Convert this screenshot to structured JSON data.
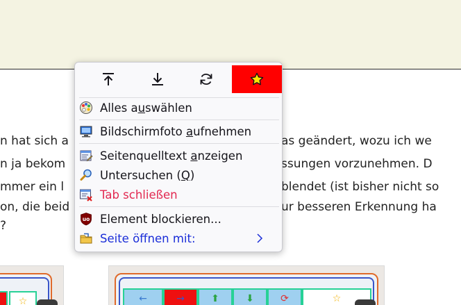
{
  "article": {
    "lines": [
      "n hat sich a",
      "as geändert, wozu ich we",
      "n ja bekom",
      "ssungen vorzunehmen. D",
      "mmer ein l",
      "blendet (ist bisher nicht so",
      "on, die beid",
      "ur besseren Erkennung ha",
      "?"
    ]
  },
  "thumb_right": {
    "cells": [
      "←",
      "→",
      "⬆",
      "⬇",
      "⟳",
      "☆"
    ]
  },
  "thumb_left": {
    "cells": [
      "",
      "☆"
    ]
  },
  "menu": {
    "nav": [
      {
        "name": "scroll-top",
        "icon": "scroll-top-icon"
      },
      {
        "name": "scroll-bottom",
        "icon": "scroll-bottom-icon"
      },
      {
        "name": "reload",
        "icon": "reload-icon"
      },
      {
        "name": "bookmark",
        "icon": "star-icon"
      }
    ],
    "items": [
      {
        "pre": "Alles a",
        "access": "u",
        "post": "swählen",
        "icon": "palette-icon"
      },
      {
        "pre": "Bildschirmfoto ",
        "access": "a",
        "post": "ufnehmen",
        "icon": "screenshot-icon"
      },
      {
        "pre": "Seitenquelltext ",
        "access": "a",
        "post": "nzeigen",
        "icon": "view-source-icon"
      },
      {
        "pre": "Untersuchen (",
        "access": "Q",
        "post": ")",
        "icon": "magnifier-icon"
      },
      {
        "pre": "Tab schließen",
        "access": "",
        "post": "",
        "icon": "close-tab-icon"
      },
      {
        "pre": "Element blockieren...",
        "access": "",
        "post": "",
        "icon": "ublock-icon"
      },
      {
        "pre": "Seite öffnen mit:",
        "access": "",
        "post": "",
        "icon": "open-with-icon"
      }
    ]
  },
  "colors": {
    "accent_red": "#ff0000",
    "danger_text": "#e22850",
    "link_text": "#1a2dd8",
    "top_band": "#f4f3e2"
  }
}
